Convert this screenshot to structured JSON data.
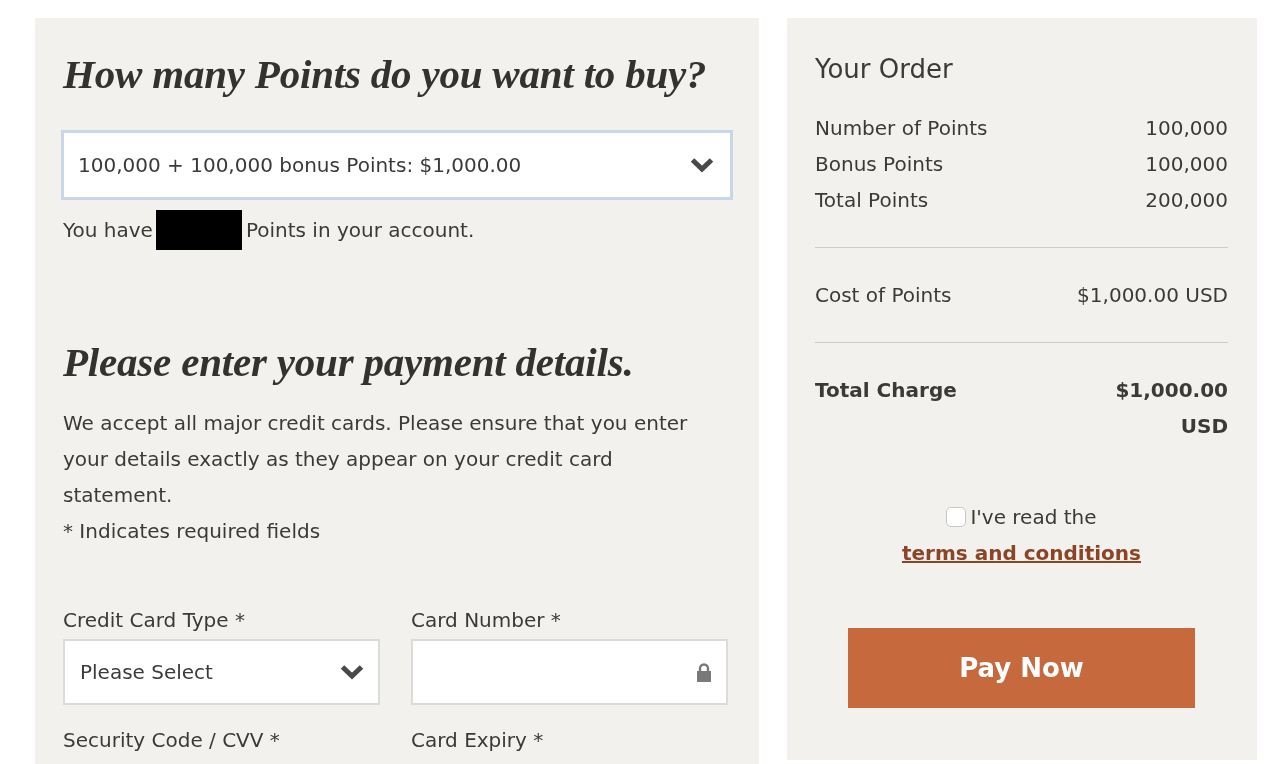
{
  "points_section": {
    "heading": "How many Points do you want to buy?",
    "points_select": {
      "value": "100,000 + 100,000 bonus Points: $1,000.00",
      "focused": true
    },
    "balance": {
      "before": "You have",
      "redacted": true,
      "after": "Points in your account."
    }
  },
  "payment_section": {
    "heading": "Please enter your payment details.",
    "intro": "We accept all major credit cards. Please ensure that you enter your details exactly as they appear on your credit card statement.",
    "required_note": "* Indicates required fields",
    "fields": [
      {
        "kind": "select",
        "label": "Credit Card Type *",
        "value": "Please Select"
      },
      {
        "kind": "secure_input",
        "label": "Card Number *"
      },
      {
        "kind": "label_only",
        "label": "Security Code / CVV *"
      },
      {
        "kind": "label_only",
        "label": "Card Expiry *"
      }
    ]
  },
  "order_summary": {
    "title": "Your Order",
    "sections": [
      {
        "rows": [
          {
            "kind": "line",
            "label": "Number of Points",
            "value": "100,000"
          },
          {
            "kind": "line",
            "label": "Bonus Points",
            "value": "100,000"
          },
          {
            "kind": "line",
            "label": "Total Points",
            "value": "200,000"
          }
        ]
      },
      {
        "rows": [
          {
            "kind": "line",
            "label": "Cost of Points",
            "value": "$1,000.00 USD"
          }
        ]
      },
      {
        "rows": [
          {
            "kind": "total",
            "label": "Total Charge",
            "value": "$1,000.00 USD"
          }
        ]
      }
    ],
    "terms": {
      "text": "I've read the",
      "link": "terms and conditions",
      "checked": false
    },
    "pay_button": {
      "label": "Pay Now"
    }
  }
}
